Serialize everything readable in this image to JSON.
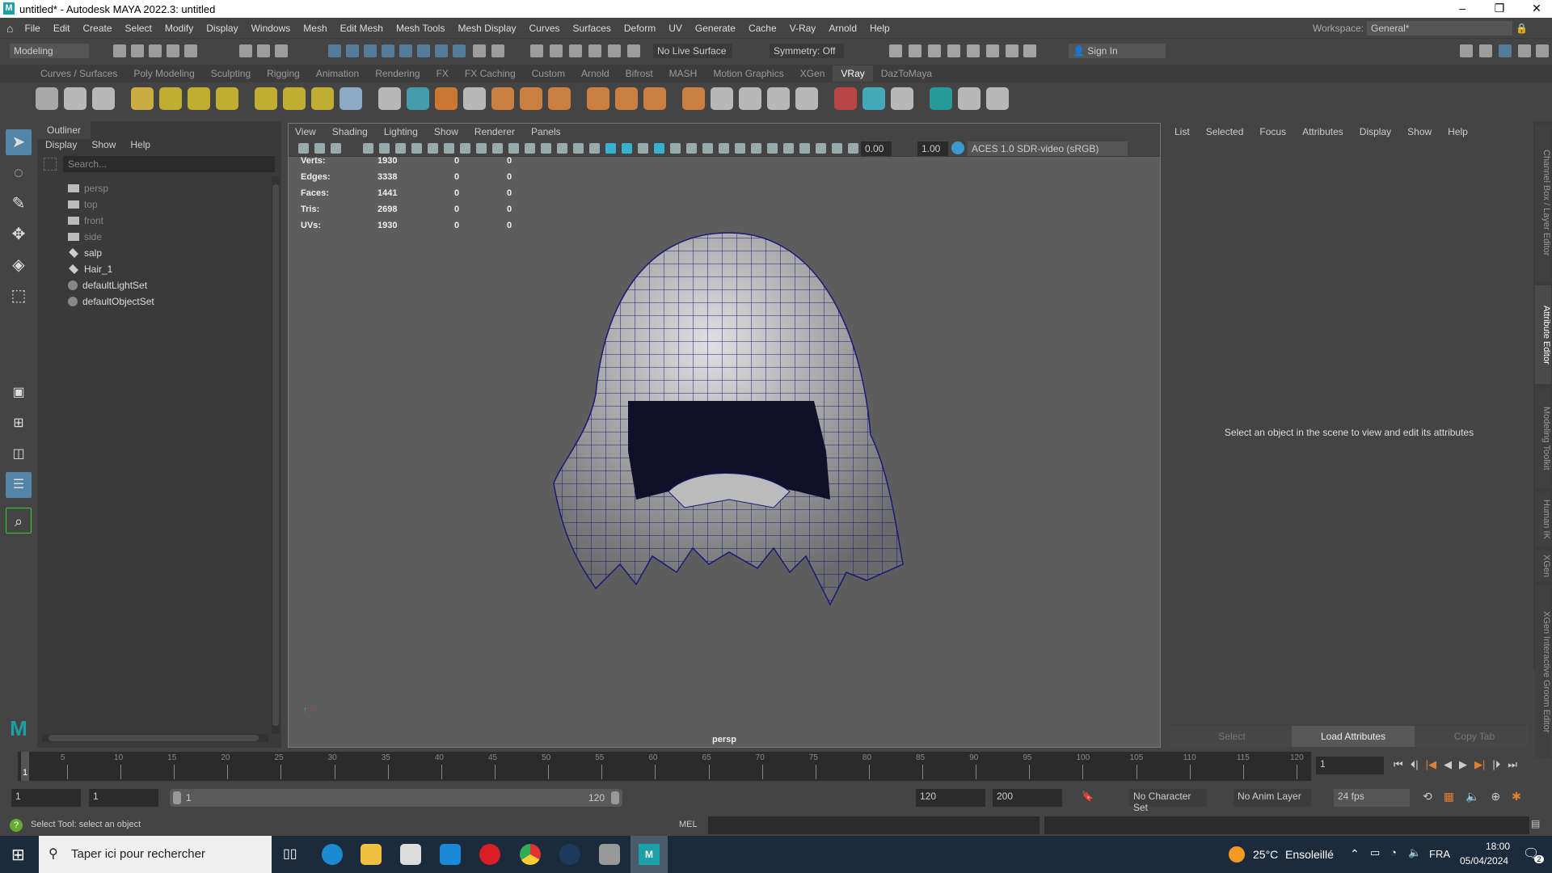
{
  "window": {
    "title": "untitled* - Autodesk MAYA 2022.3: untitled",
    "logo": "M"
  },
  "menu": [
    "File",
    "Edit",
    "Create",
    "Select",
    "Modify",
    "Display",
    "Windows",
    "Mesh",
    "Edit Mesh",
    "Mesh Tools",
    "Mesh Display",
    "Curves",
    "Surfaces",
    "Deform",
    "UV",
    "Generate",
    "Cache",
    "V-Ray",
    "Arnold",
    "Help"
  ],
  "workspace": {
    "label": "Workspace:",
    "value": "General*"
  },
  "status": {
    "mode": "Modeling",
    "live_surface": "No Live Surface",
    "symmetry": "Symmetry: Off",
    "sign_in": "Sign In"
  },
  "shelf_tabs": [
    "Curves / Surfaces",
    "Poly Modeling",
    "Sculpting",
    "Rigging",
    "Animation",
    "Rendering",
    "FX",
    "FX Caching",
    "Custom",
    "Arnold",
    "Bifrost",
    "MASH",
    "Motion Graphics",
    "XGen",
    "VRay",
    "DazToMaya"
  ],
  "active_shelf_tab": "VRay",
  "shelf_icon_colors": [
    "#bbb",
    "#ccc",
    "#ccc",
    "#e0c040",
    "#d8c030",
    "#d8c030",
    "#d8c030",
    "#d8c030",
    "#d8c030",
    "#d8c030",
    "#9bd",
    "#ccc",
    "#4ab",
    "#e08030",
    "#ccc",
    "#e08a40",
    "#e08a40",
    "#e08a40",
    "#e08a40",
    "#e08a40",
    "#e08a40",
    "#e08a40",
    "#ccc",
    "#ccc",
    "#ccc",
    "#ccc",
    "#c44",
    "#4bc",
    "#ccc",
    "#2aa",
    "#ccc",
    "#ccc"
  ],
  "outliner": {
    "title": "Outliner",
    "menu": [
      "Display",
      "Show",
      "Help"
    ],
    "search_placeholder": "Search...",
    "items": [
      {
        "label": "persp",
        "type": "camera",
        "dim": true
      },
      {
        "label": "top",
        "type": "camera",
        "dim": true
      },
      {
        "label": "front",
        "type": "camera",
        "dim": true
      },
      {
        "label": "side",
        "type": "camera",
        "dim": true
      },
      {
        "label": "salp",
        "type": "mesh",
        "dim": false
      },
      {
        "label": "Hair_1",
        "type": "mesh",
        "dim": false
      },
      {
        "label": "defaultLightSet",
        "type": "set",
        "dim": false
      },
      {
        "label": "defaultObjectSet",
        "type": "set",
        "dim": false
      }
    ]
  },
  "viewport": {
    "menu": [
      "View",
      "Shading",
      "Lighting",
      "Show",
      "Renderer",
      "Panels"
    ],
    "exposure": "0.00",
    "gamma": "1.00",
    "color_space": "ACES 1.0 SDR-video (sRGB)",
    "camera": "persp",
    "hud": [
      {
        "label": "Verts:",
        "v": "1930",
        "a": "0",
        "b": "0"
      },
      {
        "label": "Edges:",
        "v": "3338",
        "a": "0",
        "b": "0"
      },
      {
        "label": "Faces:",
        "v": "1441",
        "a": "0",
        "b": "0"
      },
      {
        "label": "Tris:",
        "v": "2698",
        "a": "0",
        "b": "0"
      },
      {
        "label": "UVs:",
        "v": "1930",
        "a": "0",
        "b": "0"
      }
    ]
  },
  "attribute_editor": {
    "menu": [
      "List",
      "Selected",
      "Focus",
      "Attributes",
      "Display",
      "Show",
      "Help"
    ],
    "message": "Select an object in the scene to view and edit its attributes",
    "select": "Select",
    "load": "Load Attributes",
    "copy": "Copy Tab"
  },
  "side_tabs": [
    "Channel Box / Layer Editor",
    "Attribute Editor",
    "Modeling Toolkit",
    "Human IK",
    "XGen",
    "XGen Interactive Groom Editor"
  ],
  "timeline": {
    "start": 1,
    "end": 120,
    "current": "1",
    "ticks": [
      "5",
      "10",
      "15",
      "20",
      "25",
      "30",
      "35",
      "40",
      "45",
      "50",
      "55",
      "60",
      "65",
      "70",
      "75",
      "80",
      "85",
      "90",
      "95",
      "100",
      "105",
      "110",
      "115",
      "120"
    ],
    "current_marker": "1"
  },
  "range": {
    "start": "1",
    "min": "1",
    "slider_start": "1",
    "slider_end": "120",
    "end": "120",
    "max": "200",
    "character_set": "No Character Set",
    "anim_layer": "No Anim Layer",
    "fps": "24 fps"
  },
  "command": {
    "help": "Select Tool: select an object",
    "lang": "MEL"
  },
  "taskbar": {
    "search": "Taper ici pour rechercher",
    "weather_temp": "25°C",
    "weather": "Ensoleillé",
    "lang": "FRA",
    "time": "18:00",
    "date": "05/04/2024",
    "notifications": "2"
  }
}
